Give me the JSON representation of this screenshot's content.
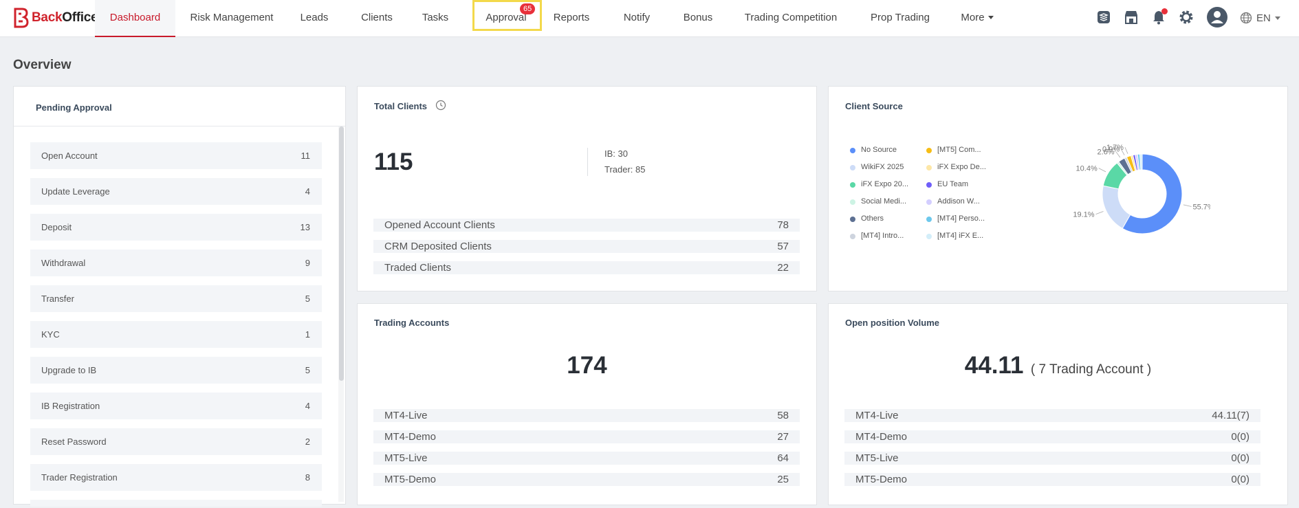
{
  "brand": {
    "name_a": "Back",
    "name_b": "Office"
  },
  "nav": [
    {
      "label": "Dashboard"
    },
    {
      "label": "Risk Management"
    },
    {
      "label": "Leads"
    },
    {
      "label": "Clients"
    },
    {
      "label": "Tasks"
    },
    {
      "label": "Approval"
    },
    {
      "label": "Reports"
    },
    {
      "label": "Notify"
    },
    {
      "label": "Bonus"
    },
    {
      "label": "Trading Competition"
    },
    {
      "label": "Prop Trading"
    },
    {
      "label": "More"
    }
  ],
  "approval_badge": "65",
  "header_tools": [
    "layers-icon",
    "store-icon",
    "bell-icon",
    "gear-icon",
    "avatar-icon",
    "globe-icon"
  ],
  "language": "EN",
  "page_title": "Overview",
  "pending_approval": {
    "title": "Pending Approval",
    "items": [
      {
        "label": "Open Account",
        "count": "11"
      },
      {
        "label": "Update Leverage",
        "count": "4"
      },
      {
        "label": "Deposit",
        "count": "13"
      },
      {
        "label": "Withdrawal",
        "count": "9"
      },
      {
        "label": "Transfer",
        "count": "5"
      },
      {
        "label": "KYC",
        "count": "1"
      },
      {
        "label": "Upgrade to IB",
        "count": "5"
      },
      {
        "label": "IB Registration",
        "count": "4"
      },
      {
        "label": "Reset Password",
        "count": "2"
      },
      {
        "label": "Trader Registration",
        "count": "8"
      }
    ]
  },
  "total_clients": {
    "title": "Total Clients",
    "total": "115",
    "ib": "IB: 30",
    "trader": "Trader: 85",
    "rows": [
      {
        "label": "Opened Account Clients",
        "value": "78"
      },
      {
        "label": "CRM Deposited Clients",
        "value": "57"
      },
      {
        "label": "Traded Clients",
        "value": "22"
      }
    ]
  },
  "client_source": {
    "title": "Client Source",
    "legend": [
      {
        "label": "No Source",
        "color": "#5b8ff9"
      },
      {
        "label": "WikiFX 2025",
        "color": "#cddcf7"
      },
      {
        "label": "iFX Expo 20...",
        "color": "#5ad8a6"
      },
      {
        "label": "Social Medi...",
        "color": "#cdf3e4"
      },
      {
        "label": "Others",
        "color": "#5d7092"
      },
      {
        "label": "[MT4] Intro...",
        "color": "#ced4de"
      },
      {
        "label": "[MT5] Com...",
        "color": "#f6bd16"
      },
      {
        "label": "iFX Expo De...",
        "color": "#fde7a7"
      },
      {
        "label": "EU Team",
        "color": "#6f5ef9"
      },
      {
        "label": "Addison W...",
        "color": "#d3ceff"
      },
      {
        "label": "[MT4] Perso...",
        "color": "#6dc8ec"
      },
      {
        "label": "[MT4] iFX E...",
        "color": "#d3eef9"
      }
    ],
    "chart_data": {
      "type": "pie",
      "labels": [
        "No Source",
        "WikiFX 2025",
        "iFX Expo 20...",
        "Social Medi...",
        "Others",
        "[MT4] Intro...",
        "[MT5] Com...",
        "iFX Expo De...",
        "EU Team",
        "Addison W...",
        "[MT4] Perso...",
        "[MT4] iFX E..."
      ],
      "values": [
        55.7,
        19.1,
        10.4,
        0.8,
        2.6,
        0.9,
        1.7,
        0.8,
        0.9,
        0.9,
        0.9,
        0.9
      ],
      "data_labels": [
        "55.7%",
        "19.1%",
        "10.4%",
        "2.6%",
        "1.7%",
        "0.9%"
      ]
    }
  },
  "trading_accounts": {
    "title": "Trading Accounts",
    "total": "174",
    "rows": [
      {
        "label": "MT4-Live",
        "value": "58"
      },
      {
        "label": "MT4-Demo",
        "value": "27"
      },
      {
        "label": "MT5-Live",
        "value": "64"
      },
      {
        "label": "MT5-Demo",
        "value": "25"
      }
    ]
  },
  "open_position": {
    "title": "Open position Volume",
    "total": "44.11",
    "accounts_note": "( 7 Trading Account )",
    "rows": [
      {
        "label": "MT4-Live",
        "value": "44.11(7)"
      },
      {
        "label": "MT4-Demo",
        "value": "0(0)"
      },
      {
        "label": "MT5-Live",
        "value": "0(0)"
      },
      {
        "label": "MT5-Demo",
        "value": "0(0)"
      }
    ]
  },
  "colors": {
    "accent": "#c8192a",
    "badge": "#e8303a",
    "highlight": "#f3d94b"
  }
}
